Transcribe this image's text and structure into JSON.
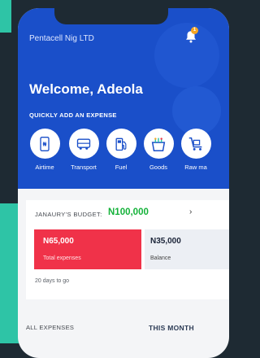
{
  "company": "Pentacell Nig LTD",
  "notifications": {
    "count": "1"
  },
  "welcome": "Welcome, Adeola",
  "quick_add_label": "QUICKLY ADD AN EXPENSE",
  "categories": [
    {
      "label": "Airtime",
      "icon": "airtime-icon"
    },
    {
      "label": "Transport",
      "icon": "bus-icon"
    },
    {
      "label": "Fuel",
      "icon": "fuel-pump-icon"
    },
    {
      "label": "Goods",
      "icon": "shopping-bag-icon"
    },
    {
      "label": "Raw ma",
      "icon": "trolley-icon"
    }
  ],
  "budget": {
    "label": "JANAURY'S BUDGET:",
    "value": "N100,000",
    "expenses_amount": "N65,000",
    "expenses_caption": "Total expenses",
    "balance_amount": "N35,000",
    "balance_caption": "Balance",
    "days_left": "20 days to go"
  },
  "section": {
    "all_expenses": "ALL EXPENSES",
    "period": "THIS MONTH"
  },
  "colors": {
    "primary": "#1a4fc9",
    "expense_red": "#f03249",
    "budget_green": "#15b23a",
    "accent_teal": "#2ec4a6"
  }
}
